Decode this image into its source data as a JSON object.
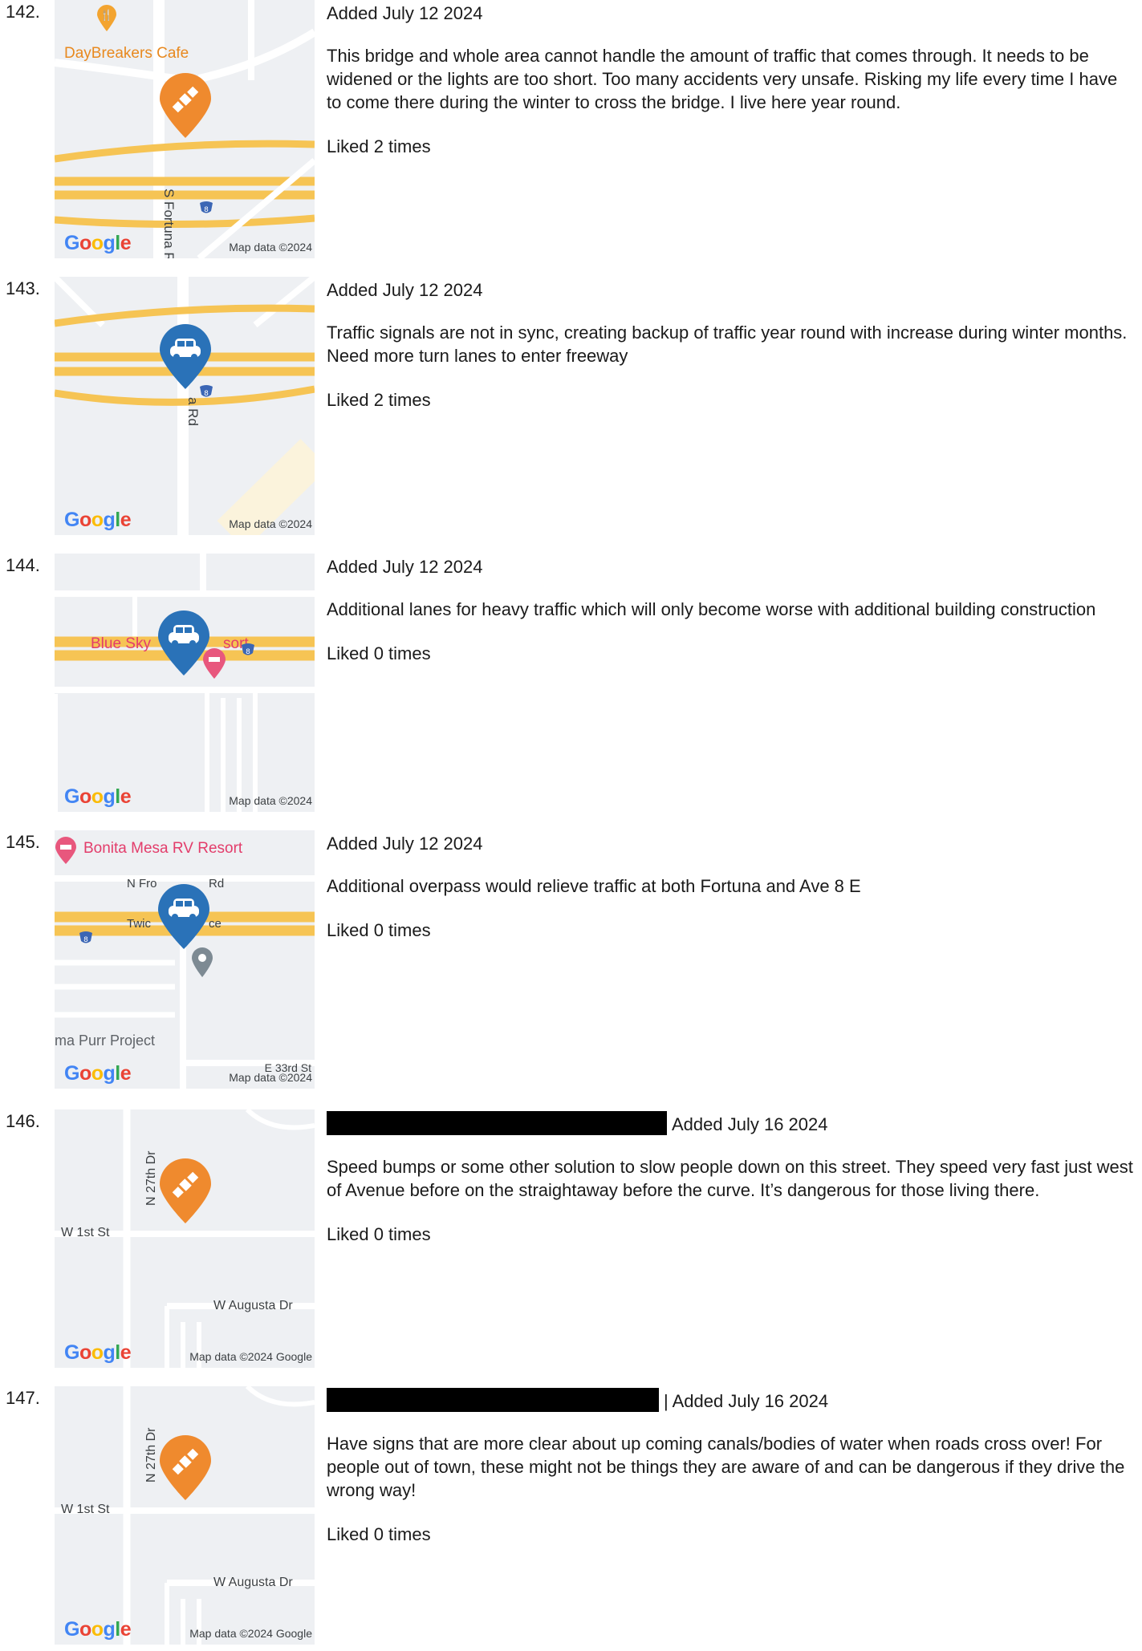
{
  "entries": [
    {
      "number": "142.",
      "added": "Added July 12 2024",
      "comment": "This bridge and whole area cannot handle the amount of traffic that comes through. It needs to be widened or the lights are too short. Too many accidents very unsafe. Risking my life every time I have to come there during the winter to cross the bridge. I live here year round.",
      "liked": "Liked 2 times",
      "map": {
        "poi": "DayBreakers Cafe",
        "street": "S Fortuna Rd",
        "shield": "8",
        "attribution": "Map data ©2024",
        "logo": "Google",
        "pin_icon": "satellite-icon",
        "pin_color": "#ef8a2e"
      }
    },
    {
      "number": "143.",
      "added": "Added July 12 2024",
      "comment": "Traffic signals are not in sync, creating backup of traffic year round with increase during winter months. Need more turn lanes to enter freeway",
      "liked": "Liked 2 times",
      "map": {
        "street": "a Rd",
        "shield": "8",
        "attribution": "Map data ©2024",
        "logo": "Google",
        "pin_icon": "car-icon",
        "pin_color": "#2a72b8"
      }
    },
    {
      "number": "144.",
      "added": "Added July 12 2024",
      "comment": "Additional lanes for heavy traffic which will only become worse with additional building construction",
      "liked": "Liked 0 times",
      "map": {
        "poi_left": "Blue Sky",
        "poi_right": "sort",
        "shield": "8",
        "attribution": "Map data ©2024",
        "logo": "Google",
        "pin_icon": "car-icon",
        "pin_color": "#2a72b8"
      }
    },
    {
      "number": "145.",
      "added": "Added July 12 2024",
      "comment": "Additional overpass would relieve traffic at both Fortuna and Ave 8 E",
      "liked": "Liked 0 times",
      "map": {
        "poi": "Bonita Mesa RV Resort",
        "road_left": "N Fro",
        "road_right": "Rd",
        "place_left": "Twic",
        "place_right": "ce",
        "bottom_poi": "ma Purr Project",
        "street": "E 33rd St",
        "shield": "8",
        "attribution": "Map data ©2024",
        "logo": "Google",
        "pin_icon": "car-icon",
        "pin_color": "#2a72b8"
      }
    },
    {
      "number": "146.",
      "added": "Added July 16 2024",
      "comment": "Speed bumps or some other solution to slow people down on this street. They speed very fast just west of Avenue before on the straightaway before the curve. It’s dangerous for those living there.",
      "liked": "Liked 0 times",
      "map": {
        "street_vertical": "N 27th Dr",
        "street_top": "W 1st St",
        "street_bottom": "W Augusta Dr",
        "attribution": "Map data ©2024 Google",
        "logo": "Google",
        "pin_icon": "satellite-icon",
        "pin_color": "#ef8a2e"
      }
    },
    {
      "number": "147.",
      "added": "| Added July 16 2024",
      "comment": "Have signs that are more clear about up coming canals/bodies of water when roads cross over! For people out of town, these might not be things they are aware of and can be dangerous if they drive the wrong way!",
      "liked": "Liked 0 times",
      "map": {
        "street_vertical": "N 27th Dr",
        "street_top": "W 1st St",
        "street_bottom": "W Augusta Dr",
        "attribution": "Map data ©2024 Google",
        "logo": "Google",
        "pin_icon": "satellite-icon",
        "pin_color": "#ef8a2e"
      }
    }
  ]
}
